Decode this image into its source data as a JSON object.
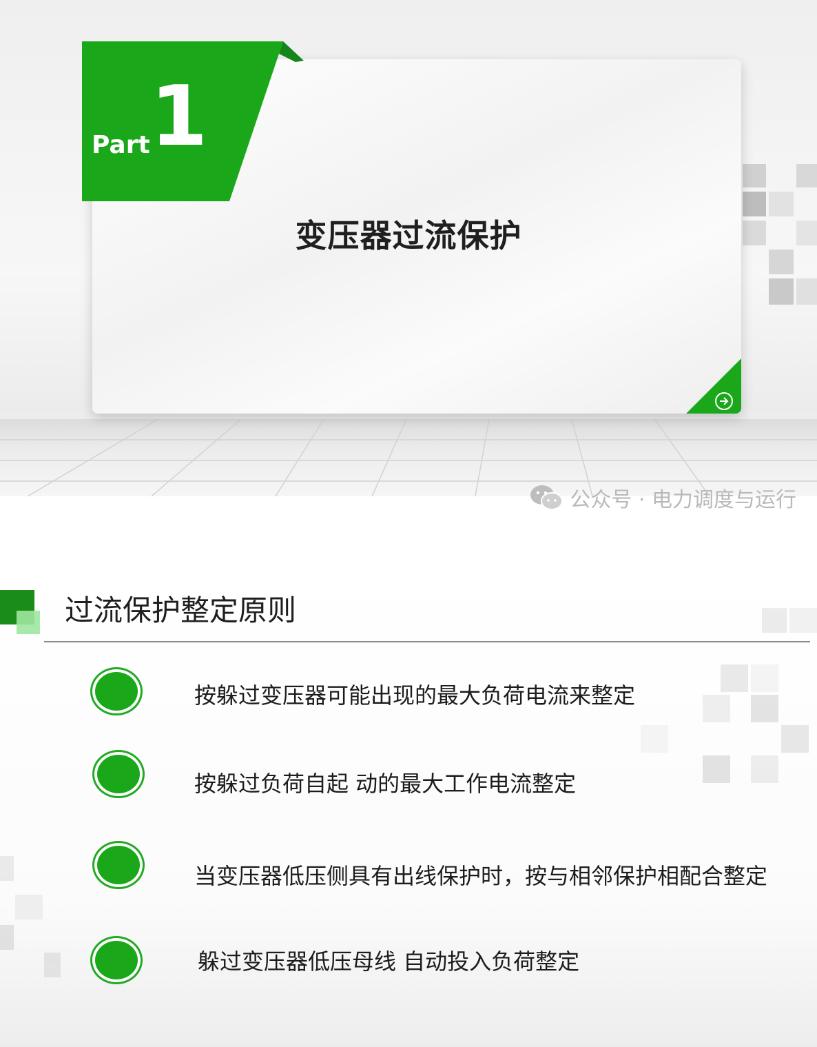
{
  "slide1": {
    "part_label": "Part",
    "part_number": "1",
    "title": "变压器过流保护",
    "next_icon": "arrow-right-circle-icon"
  },
  "watermark": {
    "icon": "wechat-icon",
    "text": "公众号 · 电力调度与运行"
  },
  "slide2": {
    "title": "过流保护整定原则",
    "items": [
      {
        "text": "按躲过变压器可能出现的最大负荷电流来整定"
      },
      {
        "text": "按躲过负荷自起 动的最大工作电流整定"
      },
      {
        "text": "当变压器低压侧具有出线保护时，按与相邻保护相配合整定"
      },
      {
        "text": "躲过变压器低压母线 自动投入负荷整定"
      }
    ]
  },
  "colors": {
    "accent_green": "#1aa81a",
    "dark_green": "#1a8c1a",
    "light_green": "#9ee59e"
  }
}
